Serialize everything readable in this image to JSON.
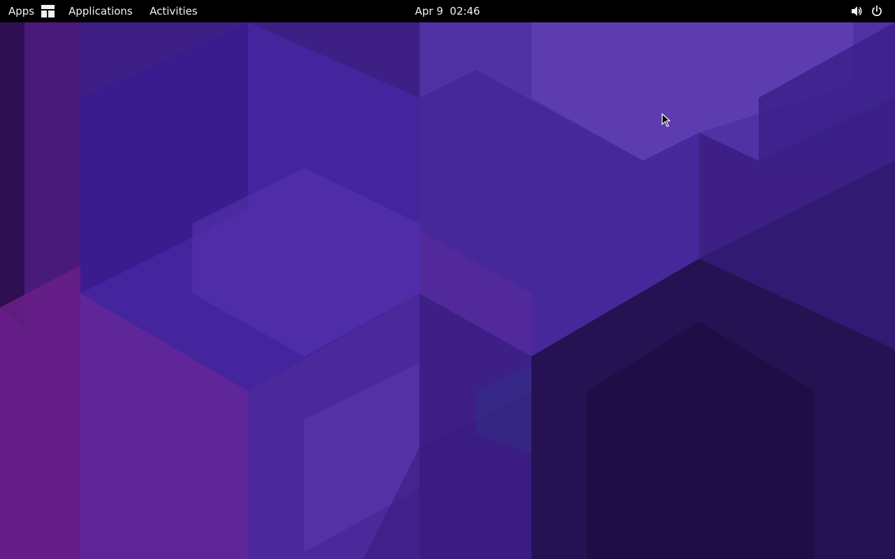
{
  "topbar": {
    "apps_label": "Apps",
    "applications_label": "Applications",
    "activities_label": "Activities",
    "clock_text": "Apr 9  02:46",
    "volume_icon": "speaker-icon",
    "power_icon": "power-icon",
    "apps_icon": "app-grid-icon"
  },
  "desktop": {
    "wallpaper": "purple-geometric-cubes",
    "colors": {
      "bar": "#000000",
      "bar_text": "#f2f2f2",
      "wallpaper_base": "#3b1c7d"
    }
  },
  "cursor": {
    "icon": "arrow-pointer-icon"
  }
}
